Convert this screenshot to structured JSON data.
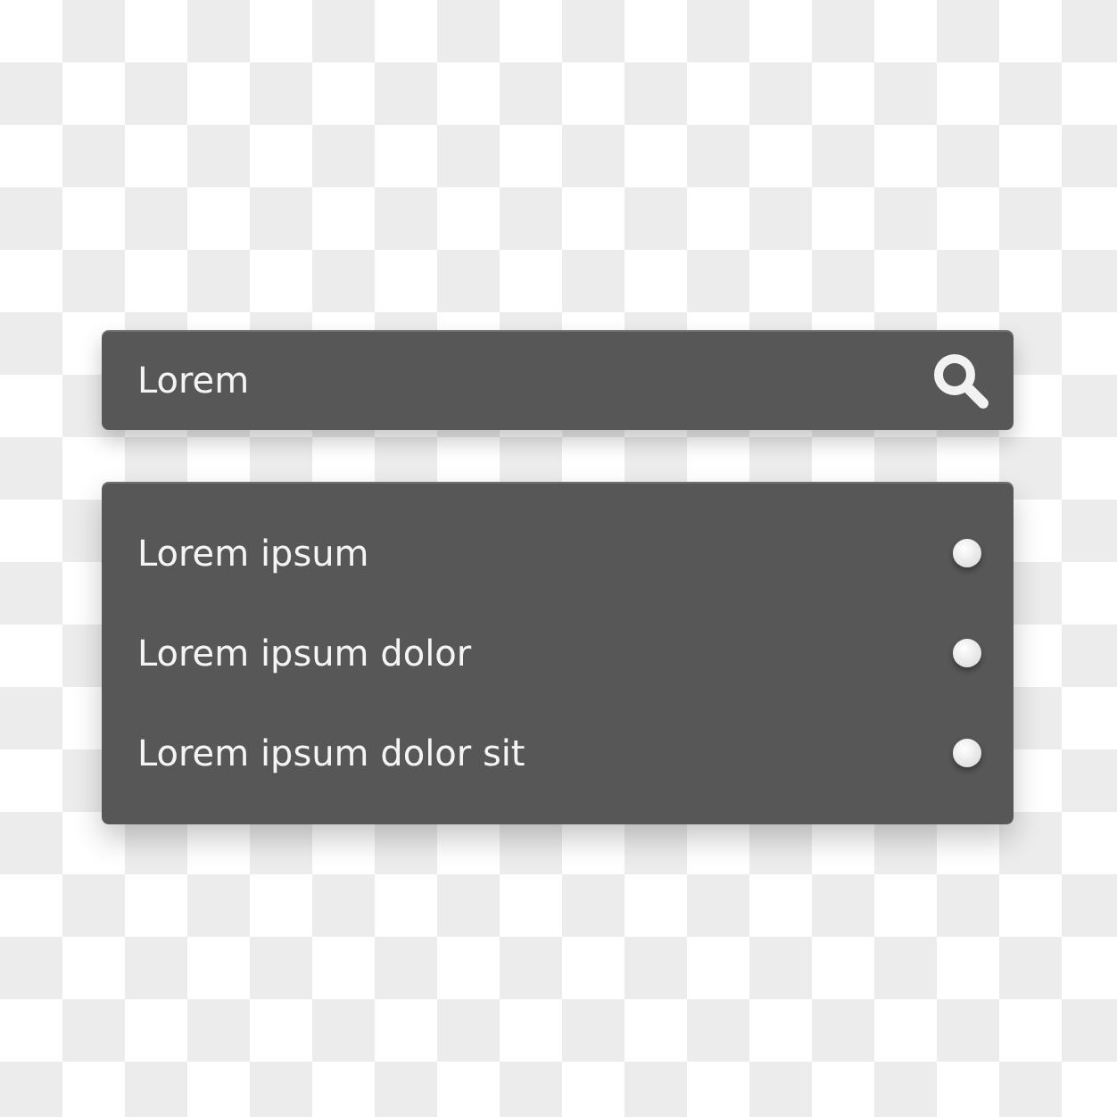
{
  "search": {
    "value": "Lorem"
  },
  "dropdown": {
    "items": [
      {
        "label": "Lorem ipsum"
      },
      {
        "label": "Lorem ipsum dolor"
      },
      {
        "label": "Lorem ipsum dolor sit"
      }
    ]
  }
}
